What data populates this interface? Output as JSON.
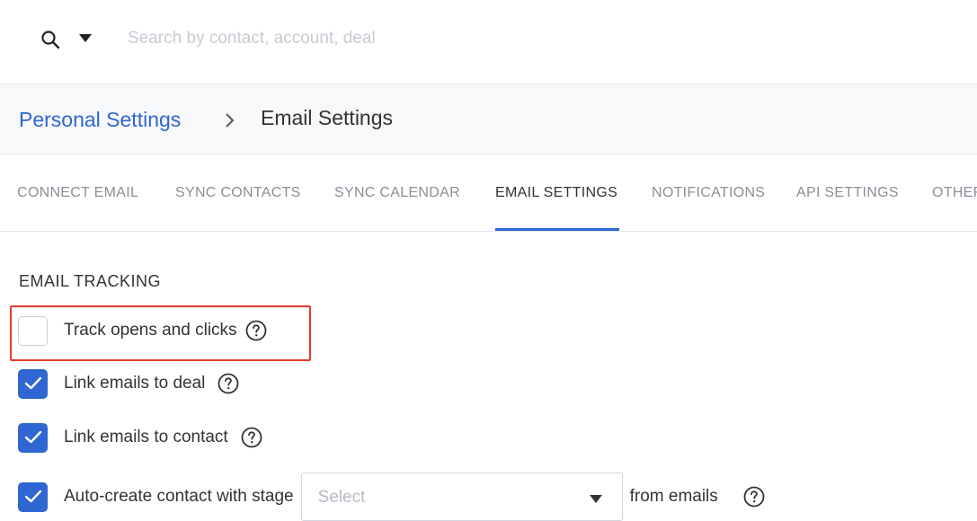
{
  "search": {
    "placeholder": "Search by contact, account, deal",
    "value": ""
  },
  "breadcrumb": {
    "parent": "Personal Settings",
    "current": "Email Settings"
  },
  "tabs": [
    {
      "label": "CONNECT  EMAIL",
      "active": false
    },
    {
      "label": "SYNC  CONTACTS",
      "active": false
    },
    {
      "label": "SYNC  CALENDAR",
      "active": false
    },
    {
      "label": "EMAIL  SETTINGS",
      "active": true
    },
    {
      "label": "NOTIFICATIONS",
      "active": false
    },
    {
      "label": "API  SETTINGS",
      "active": false
    },
    {
      "label": "OTHER",
      "active": false
    }
  ],
  "section": {
    "title": "EMAIL TRACKING",
    "options": [
      {
        "label": "Track opens and clicks",
        "checked": false
      },
      {
        "label": "Link emails to deal",
        "checked": true
      },
      {
        "label": "Link emails to contact",
        "checked": true
      },
      {
        "label": "Auto-create contact with stage",
        "checked": true,
        "select_value": "Select",
        "suffix": "from emails"
      }
    ]
  },
  "colors": {
    "accent": "#2f66d1",
    "highlight": "#e53a2b"
  }
}
